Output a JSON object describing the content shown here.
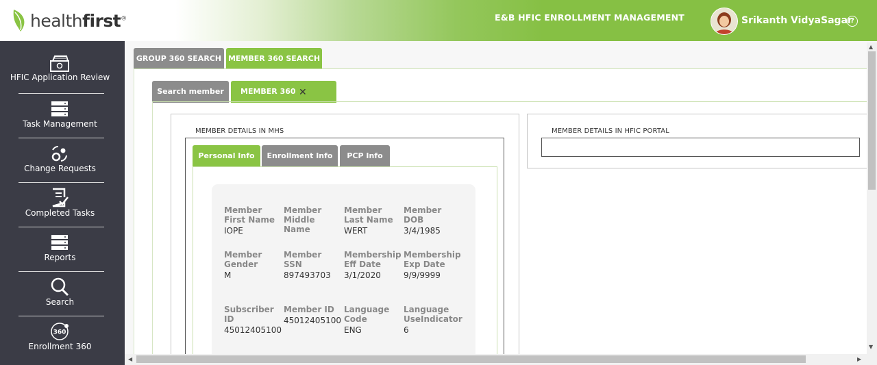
{
  "header": {
    "logo_light": "health",
    "logo_bold": "first",
    "logo_mark": "®",
    "app_title": "E&B HFIC ENROLLMENT MANAGEMENT",
    "user_name": "Srikanth VidyaSagar",
    "help_glyph": "?"
  },
  "sidebar": {
    "items": [
      {
        "label": "HFIC Application Review",
        "icon": "application-review-icon"
      },
      {
        "label": "Task Management",
        "icon": "task-list-icon"
      },
      {
        "label": "Change Requests",
        "icon": "change-requests-icon"
      },
      {
        "label": "Completed Tasks",
        "icon": "completed-tasks-icon"
      },
      {
        "label": "Reports",
        "icon": "reports-icon"
      },
      {
        "label": "Search",
        "icon": "search-icon"
      },
      {
        "label": "Enrollment 360",
        "icon": "enrollment-360-icon",
        "badge": "360"
      }
    ]
  },
  "top_tabs": [
    {
      "label": "GROUP 360 SEARCH",
      "active": false
    },
    {
      "label": "MEMBER 360 SEARCH",
      "active": true
    }
  ],
  "sub_tabs": [
    {
      "label": "Search member",
      "active": false
    },
    {
      "label": "MEMBER 360",
      "active": true,
      "close": "✕"
    }
  ],
  "mhs_panel": {
    "title": "MEMBER DETAILS IN MHS",
    "tabs": [
      {
        "label": "Personal Info",
        "active": true
      },
      {
        "label": "Enrollment Info",
        "active": false
      },
      {
        "label": "PCP Info",
        "active": false
      }
    ]
  },
  "hfic_panel": {
    "title": "MEMBER DETAILS IN HFIC PORTAL"
  },
  "personal_info": [
    {
      "label": "Member First Name",
      "value": "IOPE"
    },
    {
      "label": "Member Middle Name",
      "value": ""
    },
    {
      "label": "Member Last Name",
      "value": "WERT"
    },
    {
      "label": "Member DOB",
      "value": "3/4/1985"
    },
    {
      "label": "Member Gender",
      "value": "M"
    },
    {
      "label": "Member SSN",
      "value": "897493703"
    },
    {
      "label": "Membership Eff Date",
      "value": "3/1/2020"
    },
    {
      "label": "Membership Exp Date",
      "value": "9/9/9999"
    },
    {
      "label": "Subscriber ID",
      "value": "45012405100"
    },
    {
      "label": "Member ID",
      "value": "45012405100"
    },
    {
      "label": "Language Code",
      "value": "ENG"
    },
    {
      "label": "Language UseIndicator",
      "value": "6"
    }
  ],
  "colors": {
    "brand_green": "#8ac444",
    "sidebar_bg": "#3b3c46",
    "tab_grey": "#8c8c8c"
  }
}
